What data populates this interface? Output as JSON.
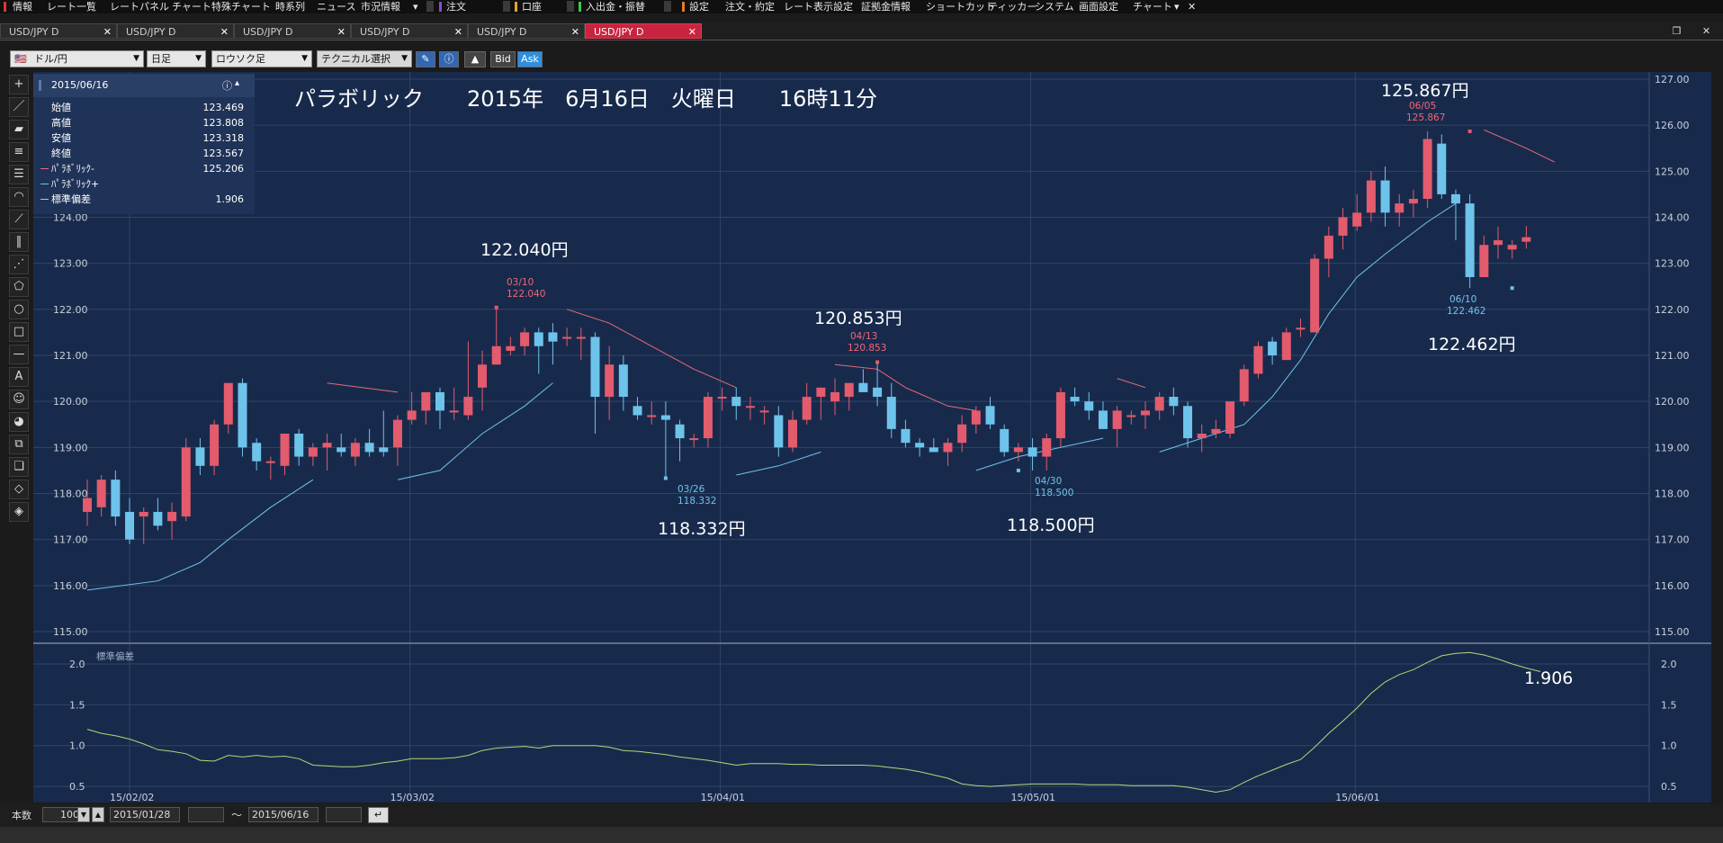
{
  "menubar": {
    "items": [
      "情報",
      "レート一覧",
      "レートパネル",
      "チャート",
      "特殊チャート",
      "時系列",
      "ニュース",
      "市況情報",
      "注文",
      "口座",
      "入出金・振替",
      "設定",
      "注文・約定",
      "レート表示設定",
      "証拠金情報",
      "ショートカット",
      "ティッカー",
      "システム",
      "画面設定",
      "チャート"
    ]
  },
  "tabs": [
    {
      "label": "USD/JPY D",
      "active": false
    },
    {
      "label": "USD/JPY D",
      "active": false
    },
    {
      "label": "USD/JPY D",
      "active": false
    },
    {
      "label": "USD/JPY D",
      "active": false
    },
    {
      "label": "USD/JPY D",
      "active": false
    },
    {
      "label": "USD/JPY D",
      "active": true
    }
  ],
  "toolbar": {
    "pair": "ドル/円",
    "period": "日足",
    "chart_type": "ロウソク足",
    "technical": "テクニカル選択",
    "bid": "Bid",
    "ask": "Ask"
  },
  "info_panel": {
    "date": "2015/06/16",
    "rows": [
      {
        "label": "始値",
        "value": "123.469"
      },
      {
        "label": "高値",
        "value": "123.808"
      },
      {
        "label": "安値",
        "value": "123.318"
      },
      {
        "label": "終値",
        "value": "123.567"
      },
      {
        "label": "ﾊﾟﾗﾎﾞﾘｯｸ-",
        "value": "125.206",
        "color": "#e56a78"
      },
      {
        "label": "ﾊﾟﾗﾎﾞﾘｯｸ+",
        "value": "",
        "color": "#6fc4ea"
      },
      {
        "label": "標準偏差",
        "value": "1.906",
        "color": "#b5d67a"
      }
    ]
  },
  "headline": "パラボリック　　2015年　6月16日　火曜日　　16時11分",
  "annotations": {
    "big": [
      "125.867円",
      "122.040円",
      "120.853円",
      "118.332円",
      "118.500円",
      "122.462円"
    ],
    "small": [
      {
        "date": "06/05",
        "value": "125.867"
      },
      {
        "date": "03/10",
        "value": "122.040"
      },
      {
        "date": "04/13",
        "value": "120.853"
      },
      {
        "date": "03/26",
        "value": "118.332"
      },
      {
        "date": "04/30",
        "value": "118.500"
      },
      {
        "date": "06/10",
        "value": "122.462"
      }
    ],
    "stddev_value": "1.906"
  },
  "price_axis": [
    "127.00",
    "126.00",
    "125.00",
    "124.00",
    "123.00",
    "122.00",
    "121.00",
    "120.00",
    "119.00",
    "118.00",
    "117.00",
    "116.00",
    "115.00"
  ],
  "date_axis": [
    "15/02/02",
    "15/03/02",
    "15/04/01",
    "15/05/01",
    "15/06/01"
  ],
  "sub_panel": {
    "title": "標準偏差",
    "ticks": [
      "2.0",
      "1.5",
      "1.0",
      "0.5"
    ]
  },
  "bottom": {
    "label": "本数",
    "count": "100",
    "from": "2015/01/28",
    "tilde": "〜",
    "to": "2015/06/16"
  },
  "colors": {
    "up": "#e35b6d",
    "down": "#6ec3ea",
    "bg": "#182a4c",
    "grid": "#2f4468",
    "psar_down": "#e56a78",
    "psar_up": "#6fc4ea",
    "std": "#b5d67a"
  },
  "chart_data": {
    "type": "candlestick",
    "x_start": "2015-01-28",
    "y_range": [
      115,
      127
    ],
    "candles": [
      {
        "d": "01/28",
        "o": 117.6,
        "h": 118.3,
        "l": 117.3,
        "c": 117.9
      },
      {
        "d": "01/29",
        "o": 117.7,
        "h": 118.4,
        "l": 117.5,
        "c": 118.3
      },
      {
        "d": "01/30",
        "o": 118.3,
        "h": 118.5,
        "l": 117.3,
        "c": 117.5
      },
      {
        "d": "02/02",
        "o": 117.6,
        "h": 117.9,
        "l": 116.9,
        "c": 117.0
      },
      {
        "d": "02/03",
        "o": 117.5,
        "h": 117.7,
        "l": 116.9,
        "c": 117.6
      },
      {
        "d": "02/04",
        "o": 117.6,
        "h": 117.9,
        "l": 117.2,
        "c": 117.3
      },
      {
        "d": "02/05",
        "o": 117.4,
        "h": 117.8,
        "l": 117.0,
        "c": 117.6
      },
      {
        "d": "02/06",
        "o": 117.5,
        "h": 119.2,
        "l": 117.4,
        "c": 119.0
      },
      {
        "d": "02/09",
        "o": 119.0,
        "h": 119.2,
        "l": 118.4,
        "c": 118.6
      },
      {
        "d": "02/10",
        "o": 118.6,
        "h": 119.6,
        "l": 118.4,
        "c": 119.5
      },
      {
        "d": "02/11",
        "o": 119.5,
        "h": 120.4,
        "l": 119.3,
        "c": 120.4
      },
      {
        "d": "02/12",
        "o": 120.4,
        "h": 120.5,
        "l": 118.8,
        "c": 119.0
      },
      {
        "d": "02/13",
        "o": 119.1,
        "h": 119.2,
        "l": 118.5,
        "c": 118.7
      },
      {
        "d": "02/16",
        "o": 118.7,
        "h": 118.8,
        "l": 118.3,
        "c": 118.7
      },
      {
        "d": "02/17",
        "o": 118.6,
        "h": 119.3,
        "l": 118.4,
        "c": 119.3
      },
      {
        "d": "02/18",
        "o": 119.3,
        "h": 119.4,
        "l": 118.6,
        "c": 118.8
      },
      {
        "d": "02/19",
        "o": 118.8,
        "h": 119.1,
        "l": 118.6,
        "c": 119.0
      },
      {
        "d": "02/20",
        "o": 119.0,
        "h": 119.3,
        "l": 118.5,
        "c": 119.1
      },
      {
        "d": "02/23",
        "o": 119.0,
        "h": 119.3,
        "l": 118.8,
        "c": 118.9
      },
      {
        "d": "02/24",
        "o": 118.8,
        "h": 119.2,
        "l": 118.6,
        "c": 119.1
      },
      {
        "d": "02/25",
        "o": 119.1,
        "h": 119.4,
        "l": 118.8,
        "c": 118.9
      },
      {
        "d": "02/26",
        "o": 119.0,
        "h": 119.8,
        "l": 118.8,
        "c": 118.9
      },
      {
        "d": "02/27",
        "o": 119.0,
        "h": 119.7,
        "l": 118.6,
        "c": 119.6
      },
      {
        "d": "03/02",
        "o": 119.6,
        "h": 120.2,
        "l": 119.5,
        "c": 119.8
      },
      {
        "d": "03/03",
        "o": 119.8,
        "h": 120.2,
        "l": 119.5,
        "c": 120.2
      },
      {
        "d": "03/04",
        "o": 120.2,
        "h": 120.3,
        "l": 119.4,
        "c": 119.8
      },
      {
        "d": "03/05",
        "o": 119.8,
        "h": 120.3,
        "l": 119.6,
        "c": 119.8
      },
      {
        "d": "03/06",
        "o": 119.7,
        "h": 121.3,
        "l": 119.6,
        "c": 120.1
      },
      {
        "d": "03/09",
        "o": 120.3,
        "h": 121.1,
        "l": 119.8,
        "c": 120.8
      },
      {
        "d": "03/10",
        "o": 120.8,
        "h": 122.04,
        "l": 120.8,
        "c": 121.2
      },
      {
        "d": "03/11",
        "o": 121.1,
        "h": 121.4,
        "l": 121.0,
        "c": 121.2
      },
      {
        "d": "03/12",
        "o": 121.2,
        "h": 121.6,
        "l": 121.0,
        "c": 121.5
      },
      {
        "d": "03/13",
        "o": 121.5,
        "h": 121.6,
        "l": 120.6,
        "c": 121.2
      },
      {
        "d": "03/16",
        "o": 121.5,
        "h": 121.7,
        "l": 120.8,
        "c": 121.3
      },
      {
        "d": "03/17",
        "o": 121.4,
        "h": 121.6,
        "l": 121.2,
        "c": 121.4
      },
      {
        "d": "03/18",
        "o": 121.4,
        "h": 121.6,
        "l": 120.9,
        "c": 121.4
      },
      {
        "d": "03/19",
        "o": 121.4,
        "h": 121.5,
        "l": 119.3,
        "c": 120.1
      },
      {
        "d": "03/20",
        "o": 120.1,
        "h": 121.2,
        "l": 119.6,
        "c": 120.8
      },
      {
        "d": "03/23",
        "o": 120.8,
        "h": 121.0,
        "l": 119.8,
        "c": 120.1
      },
      {
        "d": "03/24",
        "o": 119.9,
        "h": 120.1,
        "l": 119.6,
        "c": 119.7
      },
      {
        "d": "03/25",
        "o": 119.7,
        "h": 120.0,
        "l": 119.5,
        "c": 119.7
      },
      {
        "d": "03/26",
        "o": 119.7,
        "h": 120.0,
        "l": 118.332,
        "c": 119.6
      },
      {
        "d": "03/27",
        "o": 119.5,
        "h": 119.6,
        "l": 118.7,
        "c": 119.2
      },
      {
        "d": "03/30",
        "o": 119.2,
        "h": 119.3,
        "l": 119.0,
        "c": 119.2
      },
      {
        "d": "03/31",
        "o": 119.2,
        "h": 120.2,
        "l": 119.0,
        "c": 120.1
      },
      {
        "d": "04/01",
        "o": 120.1,
        "h": 120.3,
        "l": 119.8,
        "c": 120.1
      },
      {
        "d": "04/02",
        "o": 120.1,
        "h": 120.3,
        "l": 119.6,
        "c": 119.9
      },
      {
        "d": "04/03",
        "o": 119.9,
        "h": 120.1,
        "l": 119.6,
        "c": 119.9
      },
      {
        "d": "04/06",
        "o": 119.8,
        "h": 119.9,
        "l": 119.5,
        "c": 119.8
      },
      {
        "d": "04/07",
        "o": 119.7,
        "h": 119.9,
        "l": 118.8,
        "c": 119.0
      },
      {
        "d": "04/08",
        "o": 119.0,
        "h": 119.8,
        "l": 118.9,
        "c": 119.6
      },
      {
        "d": "04/09",
        "o": 119.6,
        "h": 120.4,
        "l": 119.5,
        "c": 120.1
      },
      {
        "d": "04/10",
        "o": 120.1,
        "h": 120.3,
        "l": 119.6,
        "c": 120.3
      },
      {
        "d": "04/13",
        "o": 120.0,
        "h": 120.5,
        "l": 119.7,
        "c": 120.2
      },
      {
        "d": "04/14",
        "o": 120.1,
        "h": 120.4,
        "l": 119.8,
        "c": 120.4
      },
      {
        "d": "04/15",
        "o": 120.4,
        "h": 120.7,
        "l": 120.2,
        "c": 120.2
      },
      {
        "d": "04/16",
        "o": 120.3,
        "h": 120.853,
        "l": 119.9,
        "c": 120.1
      },
      {
        "d": "04/17",
        "o": 120.1,
        "h": 120.4,
        "l": 119.2,
        "c": 119.4
      },
      {
        "d": "04/20",
        "o": 119.4,
        "h": 119.6,
        "l": 119.0,
        "c": 119.1
      },
      {
        "d": "04/21",
        "o": 119.1,
        "h": 119.2,
        "l": 118.8,
        "c": 119.0
      },
      {
        "d": "04/22",
        "o": 119.0,
        "h": 119.2,
        "l": 118.9,
        "c": 118.9
      },
      {
        "d": "04/23",
        "o": 118.9,
        "h": 119.2,
        "l": 118.6,
        "c": 119.1
      },
      {
        "d": "04/24",
        "o": 119.1,
        "h": 119.7,
        "l": 118.9,
        "c": 119.5
      },
      {
        "d": "04/27",
        "o": 119.5,
        "h": 119.9,
        "l": 119.3,
        "c": 119.8
      },
      {
        "d": "04/28",
        "o": 119.9,
        "h": 120.1,
        "l": 119.4,
        "c": 119.5
      },
      {
        "d": "04/29",
        "o": 119.4,
        "h": 119.5,
        "l": 118.8,
        "c": 118.9
      },
      {
        "d": "04/30",
        "o": 118.9,
        "h": 119.1,
        "l": 118.7,
        "c": 119.0
      },
      {
        "d": "05/01",
        "o": 119.0,
        "h": 119.2,
        "l": 118.5,
        "c": 118.8
      },
      {
        "d": "05/04",
        "o": 118.8,
        "h": 119.3,
        "l": 118.5,
        "c": 119.2
      },
      {
        "d": "05/05",
        "o": 119.2,
        "h": 120.3,
        "l": 119.0,
        "c": 120.2
      },
      {
        "d": "05/06",
        "o": 120.1,
        "h": 120.3,
        "l": 119.9,
        "c": 120.0
      },
      {
        "d": "05/07",
        "o": 120.0,
        "h": 120.2,
        "l": 119.6,
        "c": 119.8
      },
      {
        "d": "05/08",
        "o": 119.8,
        "h": 120.0,
        "l": 119.4,
        "c": 119.4
      },
      {
        "d": "05/11",
        "o": 119.4,
        "h": 119.9,
        "l": 119.0,
        "c": 119.8
      },
      {
        "d": "05/12",
        "o": 119.7,
        "h": 119.8,
        "l": 119.5,
        "c": 119.7
      },
      {
        "d": "05/13",
        "o": 119.7,
        "h": 120.0,
        "l": 119.4,
        "c": 119.8
      },
      {
        "d": "05/14",
        "o": 119.8,
        "h": 120.2,
        "l": 119.6,
        "c": 120.1
      },
      {
        "d": "05/15",
        "o": 120.1,
        "h": 120.3,
        "l": 119.7,
        "c": 119.9
      },
      {
        "d": "05/18",
        "o": 119.9,
        "h": 120.0,
        "l": 119.0,
        "c": 119.2
      },
      {
        "d": "05/19",
        "o": 119.2,
        "h": 119.5,
        "l": 118.9,
        "c": 119.3
      },
      {
        "d": "05/20",
        "o": 119.3,
        "h": 119.6,
        "l": 119.2,
        "c": 119.4
      },
      {
        "d": "05/21",
        "o": 119.3,
        "h": 120.0,
        "l": 119.2,
        "c": 120.0
      },
      {
        "d": "05/22",
        "o": 120.0,
        "h": 120.8,
        "l": 119.9,
        "c": 120.7
      },
      {
        "d": "05/25",
        "o": 120.6,
        "h": 121.3,
        "l": 120.5,
        "c": 121.2
      },
      {
        "d": "05/26",
        "o": 121.3,
        "h": 121.4,
        "l": 120.8,
        "c": 121.0
      },
      {
        "d": "05/27",
        "o": 120.9,
        "h": 121.6,
        "l": 120.9,
        "c": 121.5
      },
      {
        "d": "05/28",
        "o": 121.6,
        "h": 121.8,
        "l": 121.4,
        "c": 121.6
      },
      {
        "d": "05/29",
        "o": 121.5,
        "h": 123.2,
        "l": 121.5,
        "c": 123.1
      },
      {
        "d": "06/01",
        "o": 123.1,
        "h": 123.8,
        "l": 122.7,
        "c": 123.6
      },
      {
        "d": "06/02",
        "o": 123.6,
        "h": 124.2,
        "l": 123.3,
        "c": 124.0
      },
      {
        "d": "06/03",
        "o": 123.8,
        "h": 124.5,
        "l": 123.7,
        "c": 124.1
      },
      {
        "d": "06/04",
        "o": 124.1,
        "h": 125.0,
        "l": 123.9,
        "c": 124.8
      },
      {
        "d": "06/05",
        "o": 124.8,
        "h": 125.1,
        "l": 123.8,
        "c": 124.1
      },
      {
        "d": "06/08",
        "o": 124.1,
        "h": 124.5,
        "l": 123.8,
        "c": 124.3
      },
      {
        "d": "06/09",
        "o": 124.3,
        "h": 124.6,
        "l": 124.0,
        "c": 124.4
      },
      {
        "d": "06/10",
        "o": 124.4,
        "h": 125.867,
        "l": 124.2,
        "c": 125.7
      },
      {
        "d": "06/11",
        "o": 125.6,
        "h": 125.8,
        "l": 124.4,
        "c": 124.5
      },
      {
        "d": "06/12",
        "o": 124.5,
        "h": 124.6,
        "l": 123.5,
        "c": 124.3
      },
      {
        "d": "06/15",
        "o": 124.3,
        "h": 124.5,
        "l": 122.462,
        "c": 122.7
      },
      {
        "d": "06/15b",
        "o": 122.7,
        "h": 123.6,
        "l": 122.7,
        "c": 123.4
      },
      {
        "d": "06/16",
        "o": 123.4,
        "h": 123.8,
        "l": 123.1,
        "c": 123.5
      },
      {
        "d": "06/16b",
        "o": 123.3,
        "h": 123.5,
        "l": 123.1,
        "c": 123.4
      },
      {
        "d": "06/16c",
        "o": 123.469,
        "h": 123.808,
        "l": 123.318,
        "c": 123.567
      }
    ]
  }
}
